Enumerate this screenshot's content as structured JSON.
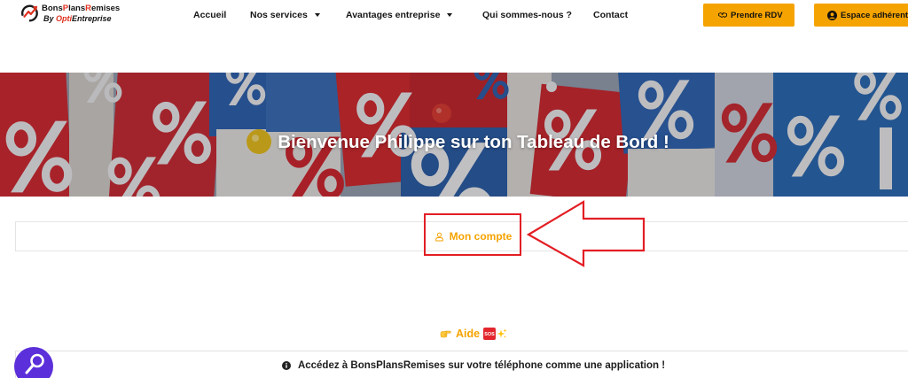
{
  "header": {
    "logo": {
      "icon": "growth-arrow-logo-icon",
      "title_parts": [
        "Bons",
        "P",
        "lans",
        "R",
        "emises"
      ],
      "subtitle_parts": [
        "By ",
        "Opti",
        "Entreprise"
      ]
    },
    "nav": {
      "items": [
        {
          "label": "Accueil"
        },
        {
          "label": "Nos services",
          "icon": "caret-down-icon"
        },
        {
          "label": "Avantages entreprise",
          "icon": "caret-down-icon"
        },
        {
          "label": "Qui sommes-nous ?"
        },
        {
          "label": "Contact"
        }
      ]
    },
    "actions": {
      "appointment": {
        "label": "Prendre RDV",
        "icon": "handshake-icon"
      },
      "member_area": {
        "label": "Espace adhérent",
        "icon": "user-circle-icon"
      }
    }
  },
  "hero": {
    "title": "Bienvenue Philippe sur ton Tableau de Bord !"
  },
  "account": {
    "label": "Mon compte",
    "icon": "user-icon"
  },
  "help": {
    "label": "Aide",
    "sos_badge": "SOS",
    "icons": [
      "pointing-hand-icon",
      "sos-icon",
      "sparkles-icon"
    ]
  },
  "app_notice": {
    "icon": "info-circle-icon",
    "text": "Accédez à BonsPlansRemises sur votre téléphone comme une application !"
  },
  "floating_widget": {
    "icon": "magnifier-icon"
  },
  "colors": {
    "accent": "#f5a300",
    "logo_red": "#e0301e",
    "annotation_red": "#e31e24",
    "widget_purple": "#5b2fd9"
  }
}
